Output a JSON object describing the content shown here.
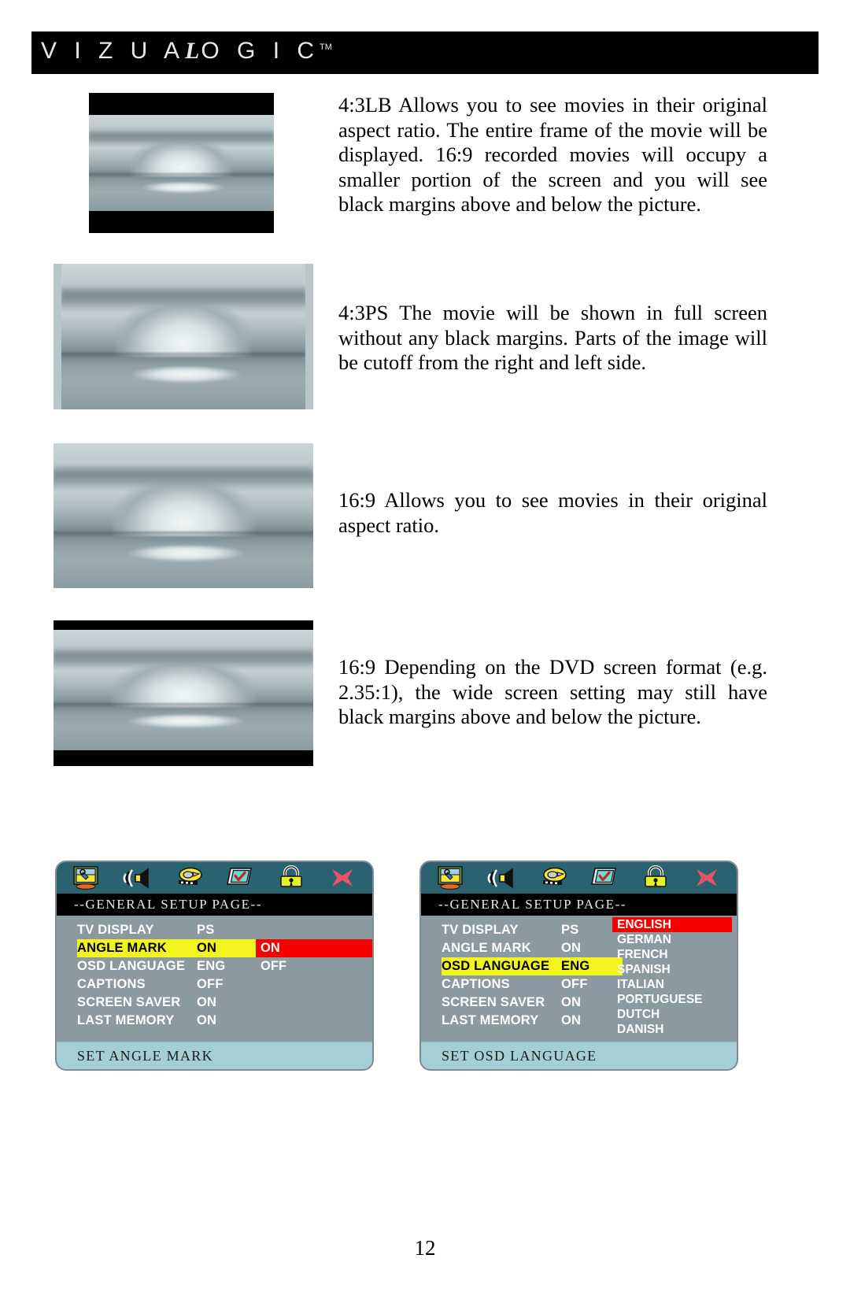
{
  "header": {
    "logo_parts": [
      "V I Z U A",
      "L",
      "O G I C"
    ],
    "logo_text": "VIZUALOGIC",
    "trademark": "TM"
  },
  "figures": [
    {
      "id": "fig-43lb",
      "caption_key": "4:3LB",
      "has_letterbox_bars": true,
      "has_side_strips": false,
      "alt": "grayscale iceberg photo letterboxed with black bars above and below"
    },
    {
      "id": "fig-43ps",
      "caption_key": "4:3PS",
      "has_letterbox_bars": false,
      "has_side_strips": true,
      "alt": "grayscale iceberg photo pan-and-scan filling frame with light side strips"
    },
    {
      "id": "fig-169",
      "caption_key": "16:9",
      "has_letterbox_bars": false,
      "has_side_strips": false,
      "alt": "grayscale iceberg photo in full 16:9 frame"
    },
    {
      "id": "fig-169-wide",
      "caption_key": "16:9 wide",
      "has_letterbox_bars": true,
      "has_side_strips": false,
      "alt": "grayscale iceberg photo 2.35:1 with black margins above and below"
    }
  ],
  "body_text": {
    "p1": "4:3LB Allows you to see movies in their original aspect ratio.  The entire frame of the movie will be displayed.  16:9 recorded movies will occupy a smaller portion of the screen and you will see black margins above and below the picture.",
    "p2": "4:3PS The movie will be shown in full screen without any black margins.   Parts of the image will be cutoff from the right and left side.",
    "p3": "16:9 Allows you to see movies in their original aspect ratio.",
    "p4": "16:9 Depending on the DVD screen format (e.g. 2.35:1), the wide screen setting may still have black margins above and below the picture."
  },
  "osd_icons": [
    {
      "name": "general-setup-icon",
      "label": "General Setup"
    },
    {
      "name": "audio-setup-icon",
      "label": "Audio Setup"
    },
    {
      "name": "video-setup-icon",
      "label": "Video Setup"
    },
    {
      "name": "preference-setup-icon",
      "label": "Preference Setup"
    },
    {
      "name": "parental-lock-icon",
      "label": "Password / Parental"
    },
    {
      "name": "exit-setup-icon",
      "label": "Exit Setup"
    }
  ],
  "osd_left": {
    "title": "--GENERAL SETUP PAGE--",
    "rows": [
      {
        "label": "TV DISPLAY",
        "value": "PS",
        "selected": false
      },
      {
        "label": "ANGLE MARK",
        "value": "ON",
        "selected": true
      },
      {
        "label": "OSD LANGUAGE",
        "value": "ENG",
        "selected": false
      },
      {
        "label": "CAPTIONS",
        "value": "OFF",
        "selected": false
      },
      {
        "label": "SCREEN SAVER",
        "value": "ON",
        "selected": false
      },
      {
        "label": "LAST MEMORY",
        "value": "ON",
        "selected": false
      }
    ],
    "choices": [
      {
        "label": "ON",
        "active": true
      },
      {
        "label": "OFF",
        "active": false
      }
    ],
    "status": "SET ANGLE MARK"
  },
  "osd_right": {
    "title": "--GENERAL SETUP PAGE--",
    "rows": [
      {
        "label": "TV DISPLAY",
        "value": "PS",
        "selected": false
      },
      {
        "label": "ANGLE MARK",
        "value": "ON",
        "selected": false
      },
      {
        "label": "OSD LANGUAGE",
        "value": "ENG",
        "selected": true
      },
      {
        "label": "CAPTIONS",
        "value": "OFF",
        "selected": false
      },
      {
        "label": "SCREEN SAVER",
        "value": "ON",
        "selected": false
      },
      {
        "label": "LAST MEMORY",
        "value": "ON",
        "selected": false
      }
    ],
    "choices": [
      {
        "label": "ENGLISH",
        "active": true
      },
      {
        "label": "GERMAN",
        "active": false
      },
      {
        "label": "FRENCH",
        "active": false
      },
      {
        "label": "SPANISH",
        "active": false
      },
      {
        "label": "ITALIAN",
        "active": false
      },
      {
        "label": "PORTUGUESE",
        "active": false
      },
      {
        "label": "DUTCH",
        "active": false
      },
      {
        "label": "DANISH",
        "active": false
      }
    ],
    "status": "SET OSD LANGUAGE"
  },
  "page_number": "12",
  "colors": {
    "header_bar": "#000000",
    "osd_iconbar": "#2a6270",
    "osd_body": "#8b9aa0",
    "osd_title_bar": "#000000",
    "osd_highlight_yellow": "#f2f51d",
    "osd_highlight_red": "#f70000",
    "osd_status_bar": "#a5ced6"
  }
}
